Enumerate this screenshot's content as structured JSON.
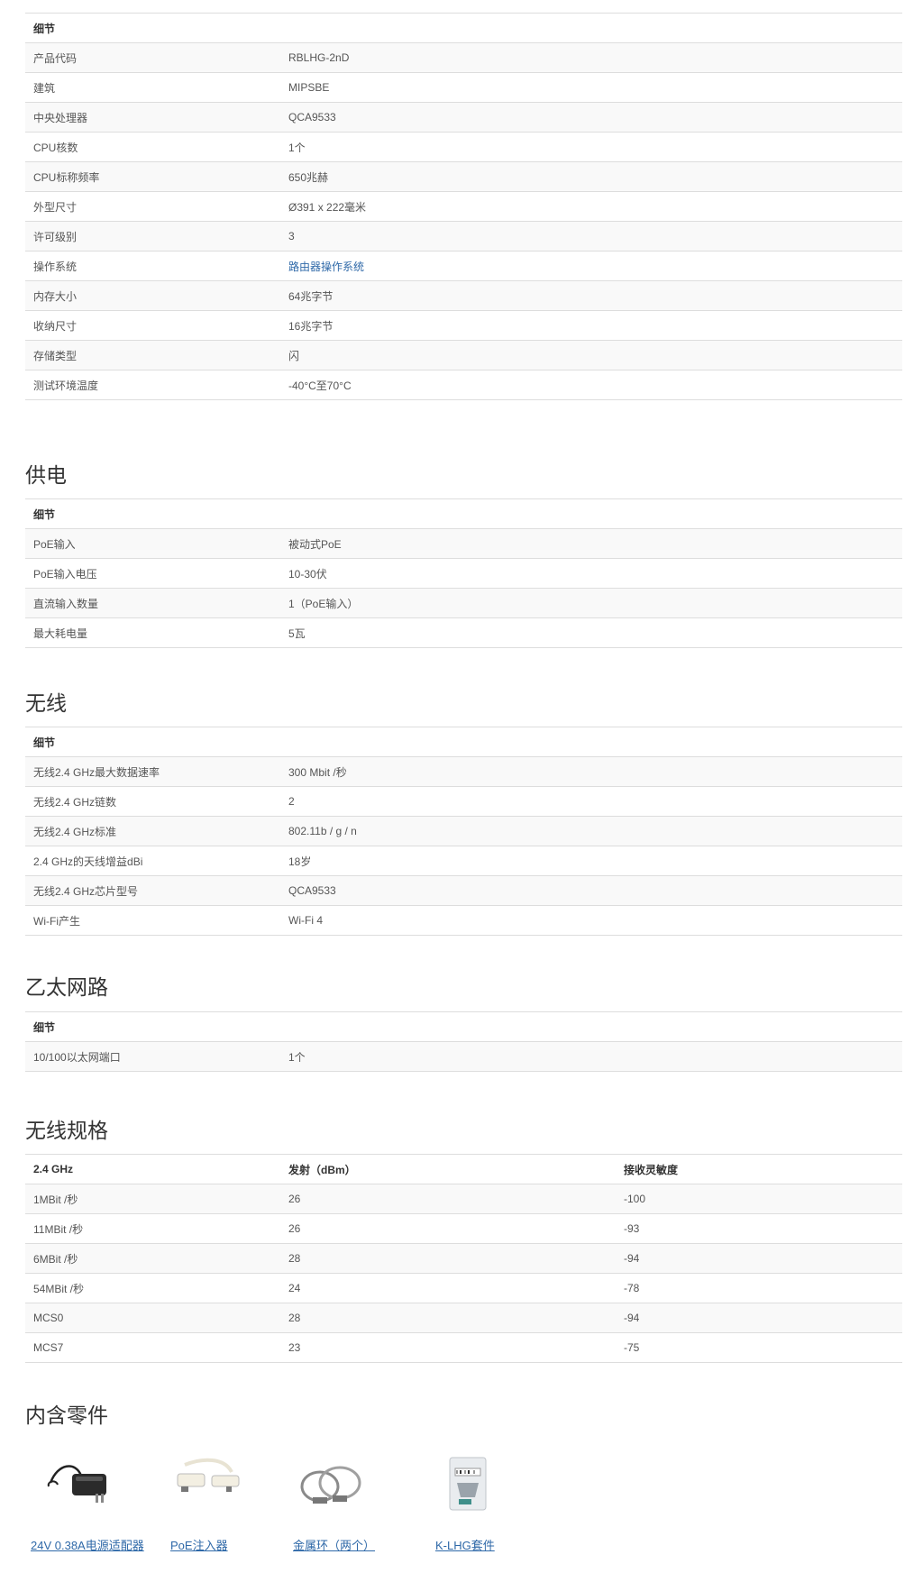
{
  "general": {
    "header": "细节",
    "rows": [
      {
        "k": "产品代码",
        "v": "RBLHG-2nD"
      },
      {
        "k": "建筑",
        "v": "MIPSBE"
      },
      {
        "k": "中央处理器",
        "v": "QCA9533"
      },
      {
        "k": "CPU核数",
        "v": "1个"
      },
      {
        "k": "CPU标称频率",
        "v": "650兆赫"
      },
      {
        "k": "外型尺寸",
        "v": "Ø391 x 222毫米"
      },
      {
        "k": "许可级别",
        "v": "3"
      },
      {
        "k": "操作系统",
        "v": "路由器操作系统"
      },
      {
        "k": "内存大小",
        "v": "64兆字节"
      },
      {
        "k": "收纳尺寸",
        "v": "16兆字节"
      },
      {
        "k": "存储类型",
        "v": "闪"
      },
      {
        "k": "测试环境温度",
        "v": "-40°C至70°C"
      }
    ]
  },
  "power": {
    "title": "供电",
    "header": "细节",
    "rows": [
      {
        "k": "PoE输入",
        "v": "被动式PoE"
      },
      {
        "k": "PoE输入电压",
        "v": "10-30伏"
      },
      {
        "k": "直流输入数量",
        "v": "1（PoE输入）"
      },
      {
        "k": "最大耗电量",
        "v": "5瓦"
      }
    ]
  },
  "wireless": {
    "title": "无线",
    "header": "细节",
    "rows": [
      {
        "k": "无线2.4 GHz最大数据速率",
        "v": "300 Mbit /秒"
      },
      {
        "k": "无线2.4 GHz链数",
        "v": "2"
      },
      {
        "k": "无线2.4 GHz标准",
        "v": "802.11b / g / n"
      },
      {
        "k": "2.4 GHz的天线增益dBi",
        "v": "18岁"
      },
      {
        "k": "无线2.4 GHz芯片型号",
        "v": "QCA9533"
      },
      {
        "k": "Wi-Fi产生",
        "v": "Wi-Fi 4"
      }
    ]
  },
  "ethernet": {
    "title": "乙太网路",
    "header": "细节",
    "rows": [
      {
        "k": "10/100以太网端口",
        "v": "1个"
      }
    ]
  },
  "wireless_specs": {
    "title": "无线规格",
    "headers": [
      "2.4 GHz",
      "发射（dBm）",
      "接收灵敏度"
    ],
    "rows": [
      [
        "1MBit /秒",
        "26",
        "-100"
      ],
      [
        "11MBit /秒",
        "26",
        "-93"
      ],
      [
        "6MBit /秒",
        "28",
        "-94"
      ],
      [
        "54MBit /秒",
        "24",
        "-78"
      ],
      [
        "MCS0",
        "28",
        "-94"
      ],
      [
        "MCS7",
        "23",
        "-75"
      ]
    ]
  },
  "included": {
    "title": "内含零件",
    "items": [
      {
        "label": "24V 0.38A电源适配器",
        "icon": "power-adapter-icon"
      },
      {
        "label": "PoE注入器",
        "icon": "poe-injector-icon"
      },
      {
        "label": "金属环（两个）",
        "icon": "metal-clamp-icon"
      },
      {
        "label": "K-LHG套件",
        "icon": "k-lhg-kit-icon"
      }
    ]
  },
  "colors": {
    "link": "#2f69a8",
    "row_stripe": "#f9f9f9",
    "border": "#dddddd"
  }
}
